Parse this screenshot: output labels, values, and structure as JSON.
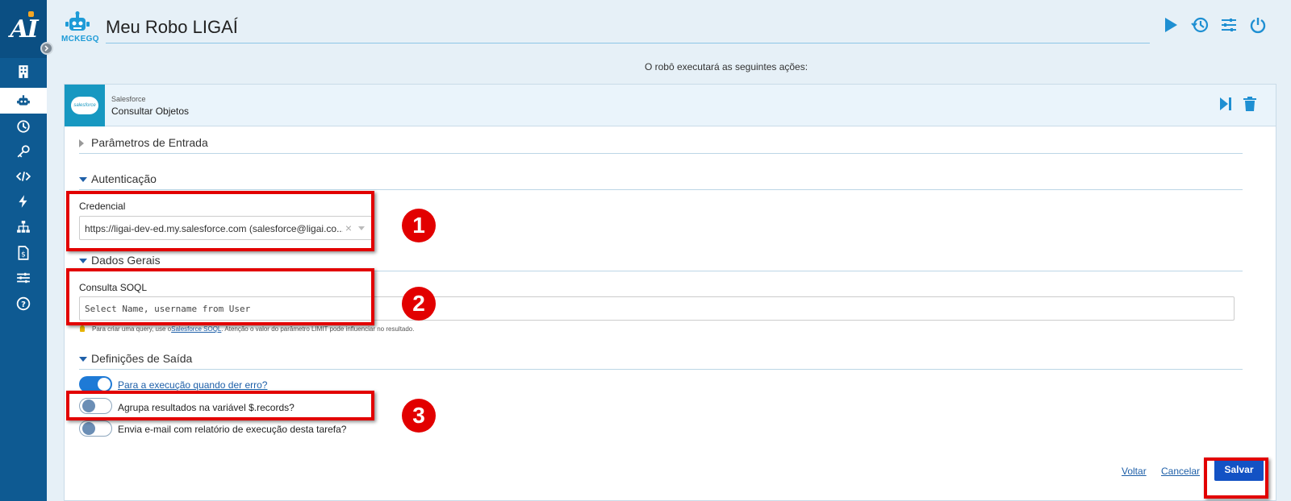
{
  "app": {
    "logo_text": "AI",
    "robot_code": "MCKEGQ",
    "title": "Meu Robo LIGAÍ",
    "subtitle": "O robô executará as seguintes ações:"
  },
  "sidebar": {
    "items": [
      {
        "name": "building-icon"
      },
      {
        "name": "robot-icon",
        "active": true
      },
      {
        "name": "history-icon"
      },
      {
        "name": "key-icon"
      },
      {
        "name": "code-icon"
      },
      {
        "name": "lightning-icon"
      },
      {
        "name": "network-icon"
      },
      {
        "name": "billing-icon"
      },
      {
        "name": "sliders-icon"
      },
      {
        "name": "help-icon"
      }
    ]
  },
  "header_actions": [
    "play-icon",
    "history-icon",
    "settings-icon",
    "power-icon"
  ],
  "card": {
    "provider": "Salesforce",
    "action": "Consultar Objetos",
    "logo_text": "salesforce",
    "sections": {
      "input": "Parâmetros de Entrada",
      "auth": "Autenticação",
      "general": "Dados Gerais",
      "output": "Definições de Saída"
    },
    "credential": {
      "label": "Credencial",
      "value": "https://ligai-dev-ed.my.salesforce.com (salesforce@ligai.co...",
      "clear": "×"
    },
    "query": {
      "label": "Consulta SOQL",
      "value": "Select Name, username from User",
      "hint_pre": "Para criar uma query, use o",
      "hint_link": "Salesforce SOQL",
      "hint_post": ". Atenção o valor do parâmetro LIMIT pode influenciar no resultado."
    },
    "toggles": [
      {
        "label": "Para a execução quando der erro?",
        "on": true
      },
      {
        "label": "Agrupa resultados na variável $.records?",
        "on": false
      },
      {
        "label": "Envia e-mail com relatório de execução desta tarefa?",
        "on": false
      }
    ],
    "buttons": {
      "back": "Voltar",
      "cancel": "Cancelar",
      "save": "Salvar"
    }
  },
  "annotations": {
    "badge1": "1",
    "badge2": "2",
    "badge3": "3"
  },
  "colors": {
    "sidebar": "#0e5a92",
    "accent": "#1e5fa8",
    "highlight": "#e20000",
    "salesforce": "#1798c1"
  }
}
